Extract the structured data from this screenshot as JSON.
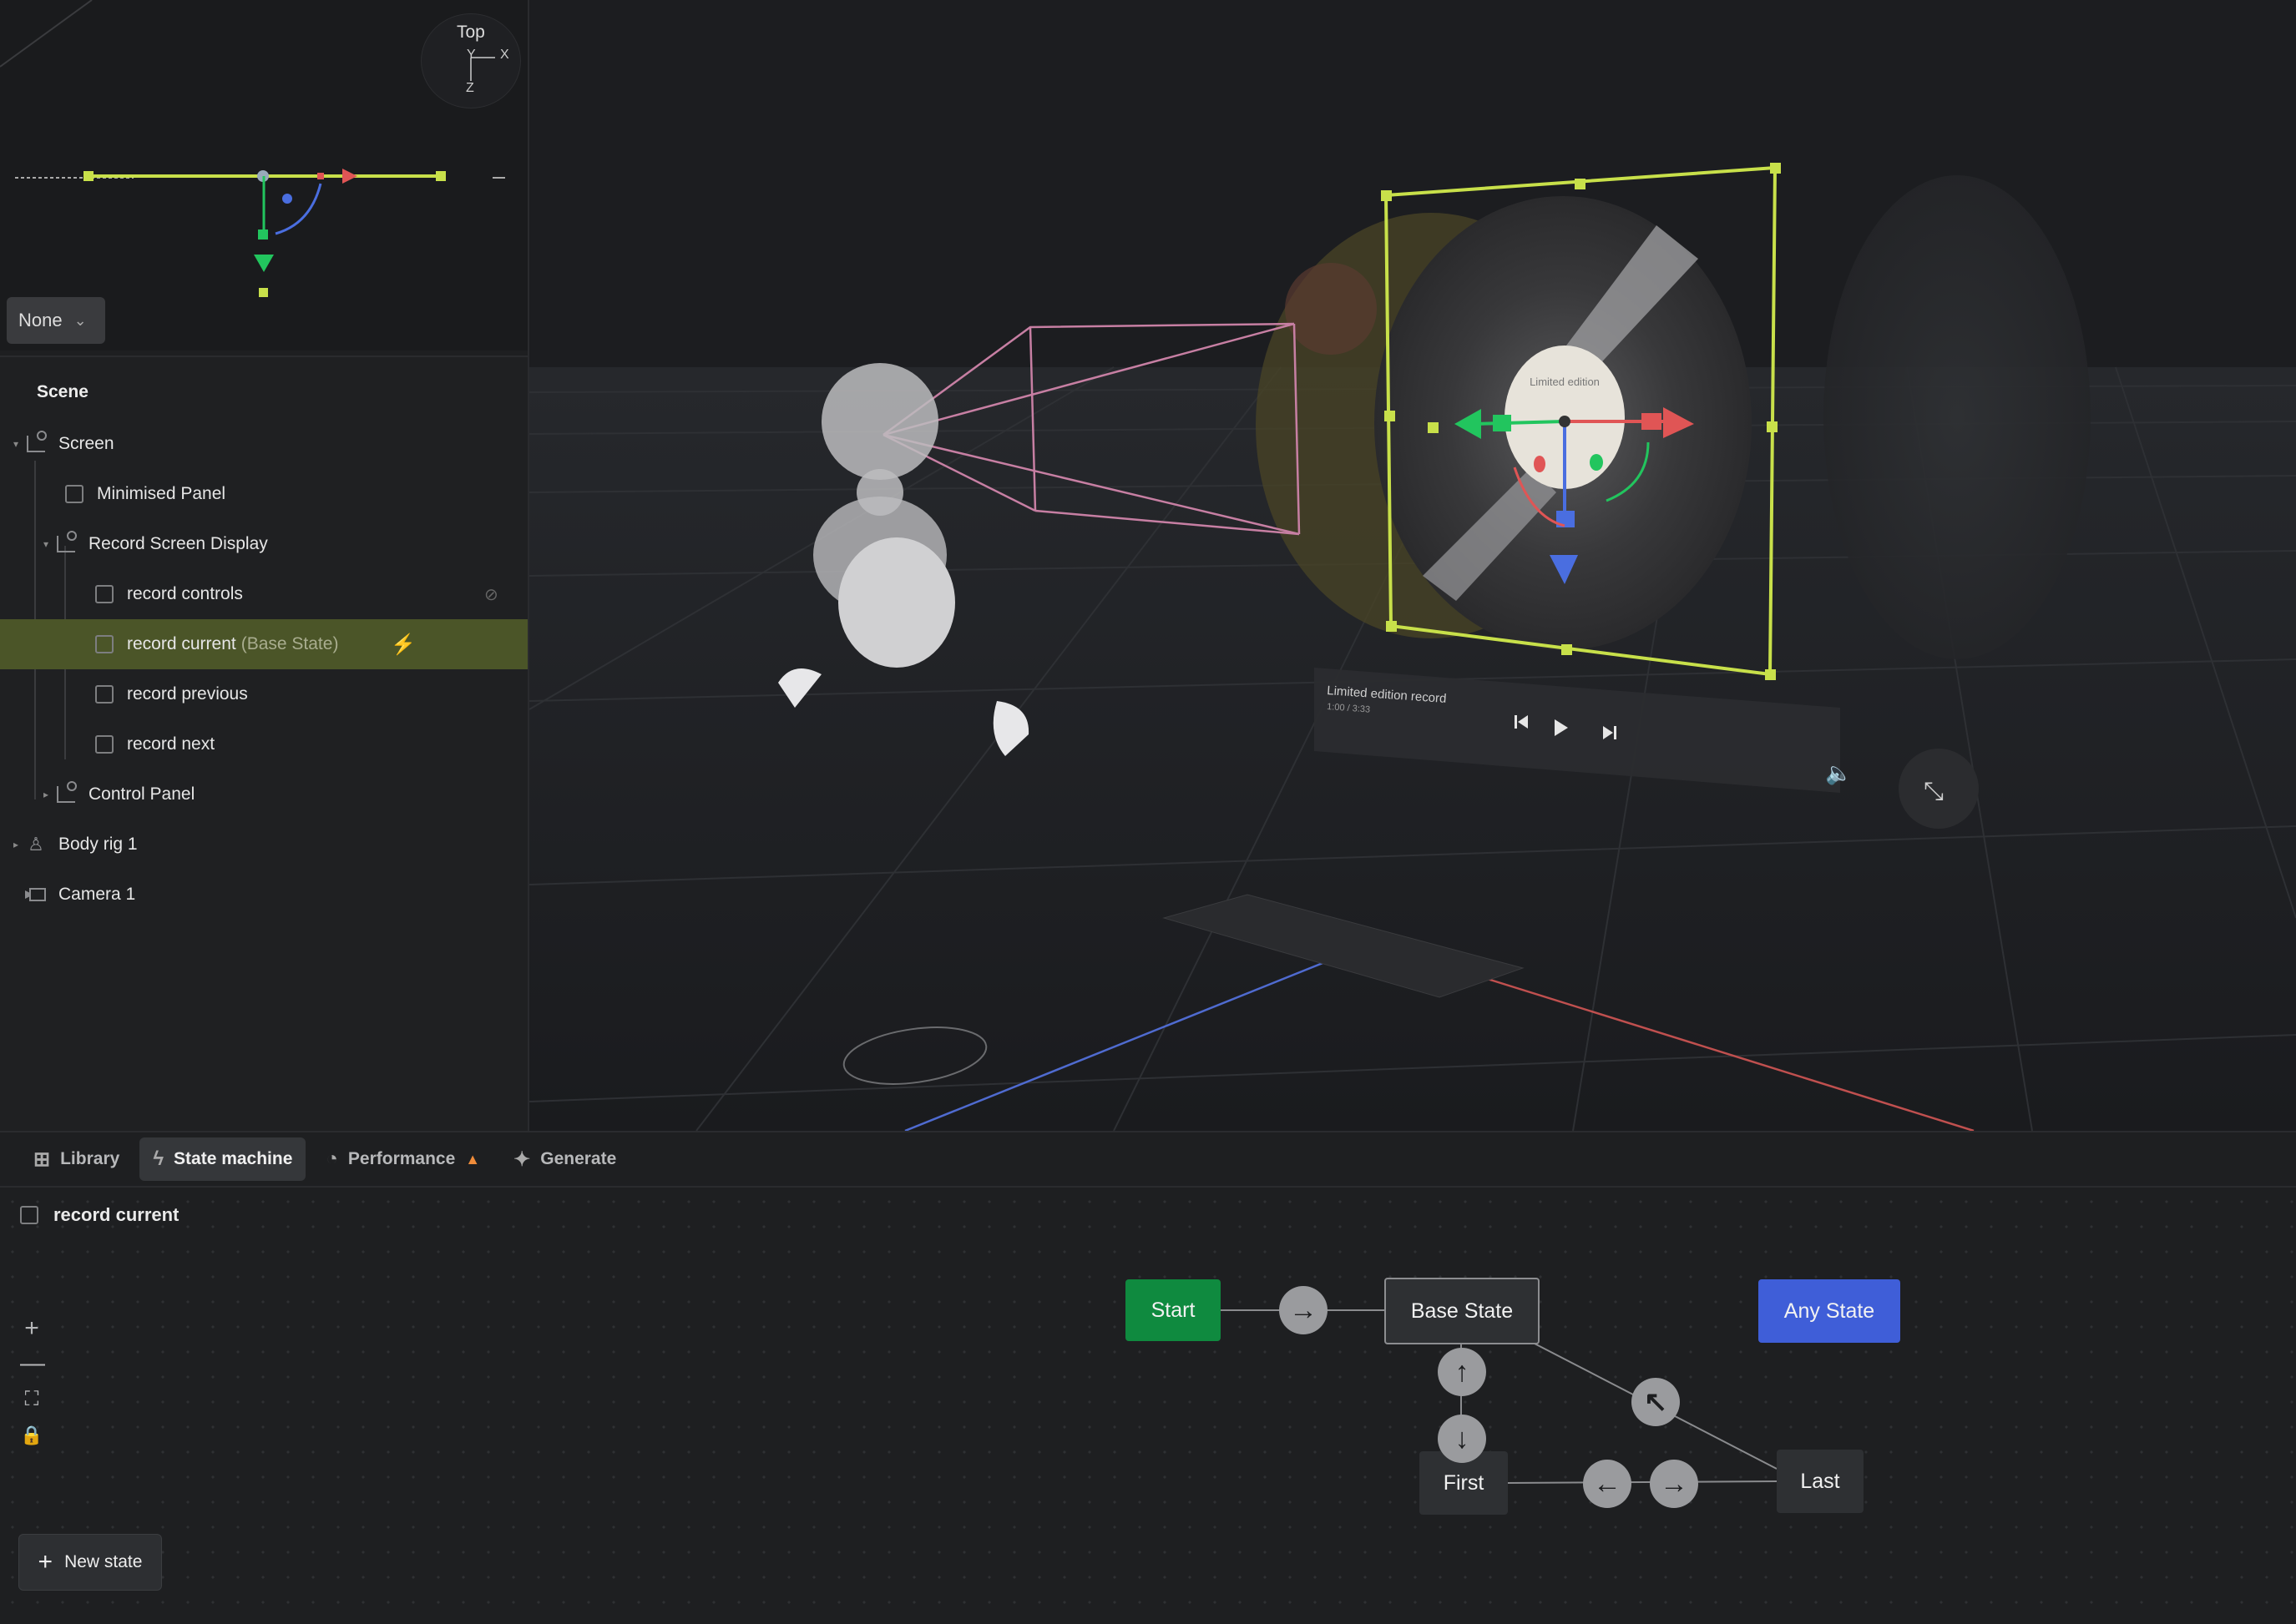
{
  "minimap": {
    "gizmo": {
      "label_top": "Top",
      "axis_y": "Y",
      "axis_x": "X",
      "axis_z": "Z"
    },
    "view_dropdown": {
      "value": "None"
    }
  },
  "scene": {
    "title": "Scene",
    "tree": [
      {
        "label": "Screen",
        "hint": "",
        "icon": "group-icon"
      },
      {
        "label": "Minimised Panel",
        "hint": "",
        "icon": "checkbox"
      },
      {
        "label": "Record Screen Display",
        "hint": "",
        "icon": "group-icon"
      },
      {
        "label": "record controls",
        "hint": "",
        "icon": "checkbox"
      },
      {
        "label": "record current",
        "hint": "(Base State)",
        "icon": "checkbox"
      },
      {
        "label": "record previous",
        "hint": "",
        "icon": "checkbox"
      },
      {
        "label": "record next",
        "hint": "",
        "icon": "checkbox"
      },
      {
        "label": "Control Panel",
        "hint": "",
        "icon": "group-icon"
      },
      {
        "label": "Body rig 1",
        "hint": "",
        "icon": "body-rig-icon"
      },
      {
        "label": "Camera 1",
        "hint": "",
        "icon": "camera-icon"
      }
    ]
  },
  "viewport": {
    "panel_title": "Limited edition record",
    "panel_subtitle": "1:00 / 3:33",
    "record_label": "Limited edition"
  },
  "tabs": [
    {
      "label": "Library",
      "icon": "library-icon"
    },
    {
      "label": "State machine",
      "icon": "bolt-icon"
    },
    {
      "label": "Performance",
      "icon": "gauge-icon"
    },
    {
      "label": "Generate",
      "icon": "sparkle-icon"
    }
  ],
  "state_machine": {
    "target": "record current",
    "new_state_label": "New state",
    "nodes": {
      "start": "Start",
      "base": "Base State",
      "any": "Any State",
      "first": "First",
      "last": "Last"
    }
  },
  "colors": {
    "accent": "#c8e04a",
    "selected_row": "#4b5528",
    "start": "#0f8a3f",
    "any_state": "#3f5ed8",
    "warning": "#f08c3a"
  }
}
